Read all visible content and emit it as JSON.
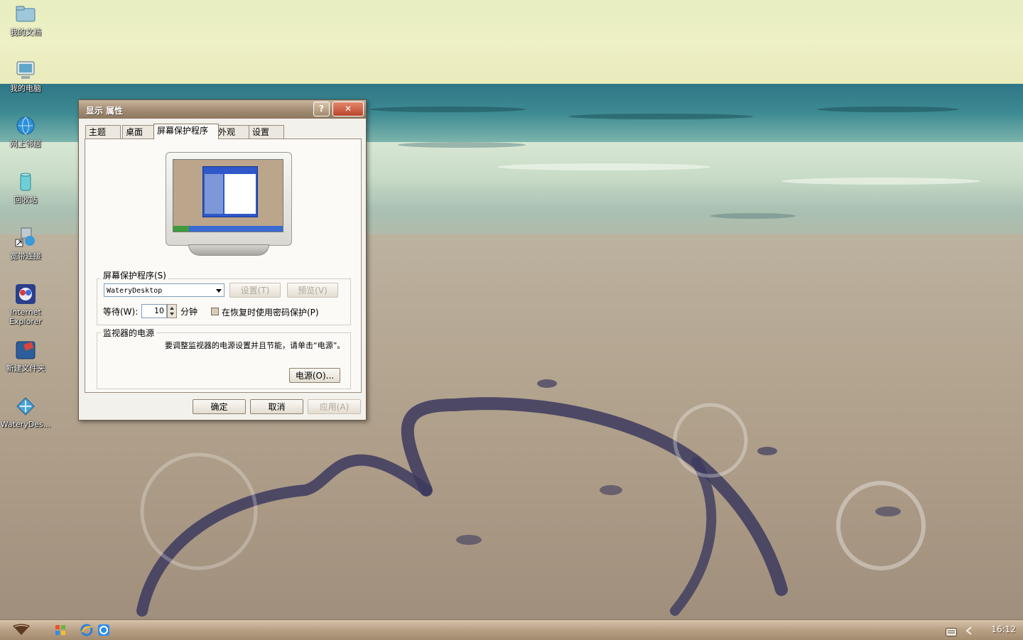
{
  "desktop": {
    "icons": [
      {
        "label": "我的文档",
        "icon": "folder-documents-icon"
      },
      {
        "label": "我的电脑",
        "icon": "computer-icon"
      },
      {
        "label": "网上邻居",
        "icon": "network-globe-icon"
      },
      {
        "label": "回收站",
        "icon": "recycle-bin-icon"
      },
      {
        "label": "宽带连接",
        "icon": "network-connection-icon"
      },
      {
        "label": "Internet Explorer",
        "icon": "internet-explorer-icon"
      },
      {
        "label": "新建文件夹",
        "icon": "new-folder-icon"
      },
      {
        "label": "WateryDes...",
        "icon": "waterydesktop-icon"
      }
    ]
  },
  "dialog": {
    "title": "显示 属性",
    "help_glyph": "?",
    "close_glyph": "✕",
    "tabs": [
      {
        "label": "主题",
        "active": false
      },
      {
        "label": "桌面",
        "active": false
      },
      {
        "label": "屏幕保护程序",
        "active": true
      },
      {
        "label": "外观",
        "active": false
      },
      {
        "label": "设置",
        "active": false
      }
    ],
    "screensaver": {
      "group_label": "屏幕保护程序(S)",
      "selected": "WateryDesktop",
      "settings_button": "设置(T)",
      "preview_button": "预览(V)",
      "wait_label": "等待(W):",
      "wait_value": "10",
      "minutes_label": "分钟",
      "password_checkbox_label": "在恢复时使用密码保护(P)",
      "password_checked": false
    },
    "power": {
      "group_label": "监视器的电源",
      "description": "要调整监视器的电源设置并且节能，请单击“电源”。",
      "power_button": "电源(O)..."
    },
    "buttons": {
      "ok": "确定",
      "cancel": "取消",
      "apply": "应用(A)"
    }
  },
  "taskbar": {
    "clock": "16:12",
    "quick_launch": [
      "windows-logo-icon",
      "internet-explorer-icon",
      "ie-blue-icon"
    ],
    "tray": [
      "keyboard-icon",
      "chevron-left-icon"
    ]
  },
  "colors": {
    "dialog_titlebar": "#a89178",
    "close_button": "#c0533a",
    "taskbar": "#b8a085"
  }
}
